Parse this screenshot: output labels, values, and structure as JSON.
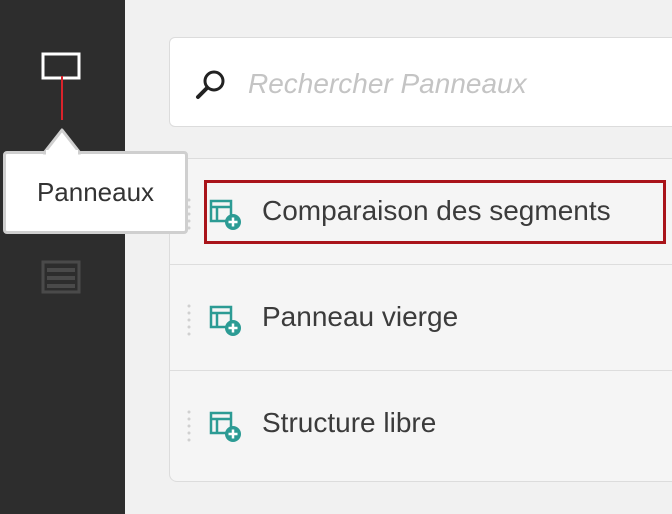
{
  "tooltip": {
    "label": "Panneaux"
  },
  "search": {
    "placeholder": "Rechercher Panneaux",
    "value": ""
  },
  "panels": [
    {
      "label": "Comparaison des segments",
      "highlighted": true
    },
    {
      "label": "Panneau vierge",
      "highlighted": false
    },
    {
      "label": "Structure libre",
      "highlighted": false
    }
  ],
  "colors": {
    "rail": "#2d2d2d",
    "accent_icon": "#2c9b94",
    "highlight": "#a9141a",
    "annotation": "#d9232b"
  },
  "icons": {
    "rail": [
      "panels-icon",
      "freeform-table-icon"
    ],
    "search": "search-icon",
    "panel_item": "add-panel-icon",
    "drag": "drag-handle-icon"
  }
}
